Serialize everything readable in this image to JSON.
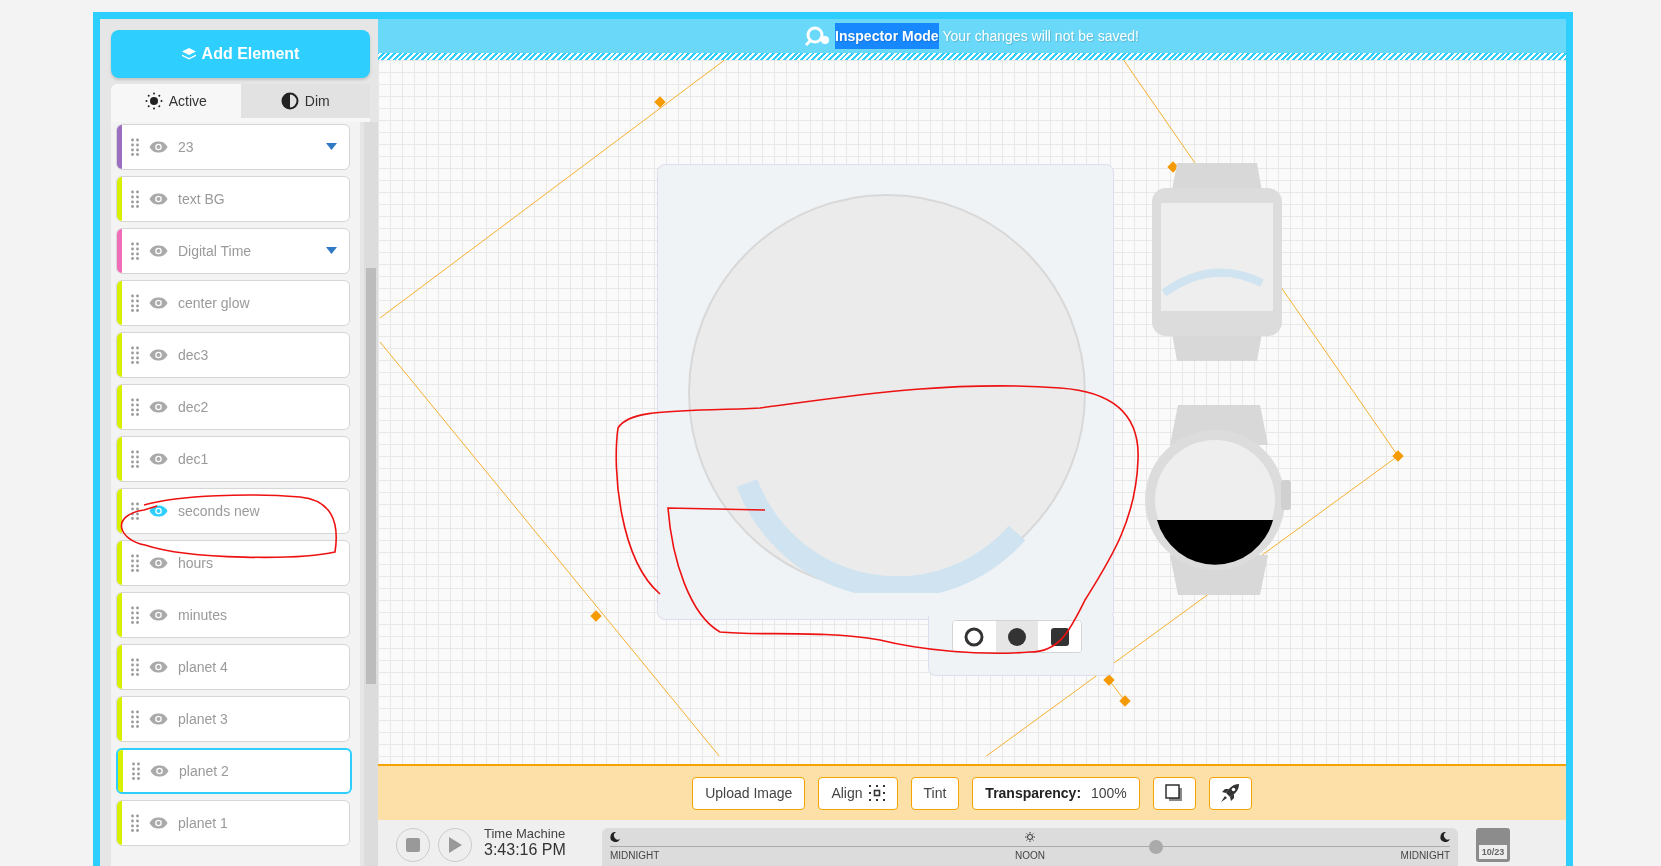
{
  "banner": {
    "mode": "Inspector Mode",
    "message": "Your changes will not be saved!"
  },
  "sidebar": {
    "add_button": "Add Element",
    "tabs": [
      {
        "label": "Active",
        "kind": "sun",
        "selected": true
      },
      {
        "label": "Dim",
        "kind": "half",
        "selected": false
      }
    ],
    "layers": [
      {
        "name": "23",
        "color": "#9b6fbf",
        "expandable": true,
        "highlighted": false,
        "selected": false
      },
      {
        "name": "text BG",
        "color": "#d8f000",
        "expandable": false,
        "highlighted": false,
        "selected": false
      },
      {
        "name": "Digital Time",
        "color": "#f06eb8",
        "expandable": true,
        "highlighted": false,
        "selected": false
      },
      {
        "name": "center glow",
        "color": "#d8f000",
        "expandable": false,
        "highlighted": false,
        "selected": false
      },
      {
        "name": "dec3",
        "color": "#d8f000",
        "expandable": false,
        "highlighted": false,
        "selected": false
      },
      {
        "name": "dec2",
        "color": "#d8f000",
        "expandable": false,
        "highlighted": false,
        "selected": false
      },
      {
        "name": "dec1",
        "color": "#d8f000",
        "expandable": false,
        "highlighted": false,
        "selected": false
      },
      {
        "name": "seconds new",
        "color": "#d8f000",
        "expandable": false,
        "highlighted": true,
        "selected": false
      },
      {
        "name": "hours",
        "color": "#d8f000",
        "expandable": false,
        "highlighted": false,
        "selected": false
      },
      {
        "name": "minutes",
        "color": "#d8f000",
        "expandable": false,
        "highlighted": false,
        "selected": false
      },
      {
        "name": "planet 4",
        "color": "#d8f000",
        "expandable": false,
        "highlighted": false,
        "selected": false
      },
      {
        "name": "planet 3",
        "color": "#d8f000",
        "expandable": false,
        "highlighted": false,
        "selected": false
      },
      {
        "name": "planet 2",
        "color": "#d8f000",
        "expandable": false,
        "highlighted": false,
        "selected": true
      },
      {
        "name": "planet 1",
        "color": "#d8f000",
        "expandable": false,
        "highlighted": false,
        "selected": false
      }
    ]
  },
  "shape_options": [
    {
      "kind": "ring",
      "selected": false
    },
    {
      "kind": "circle",
      "selected": true
    },
    {
      "kind": "square",
      "selected": false
    }
  ],
  "toolbar": [
    {
      "kind": "text",
      "label": "Upload Image"
    },
    {
      "kind": "align",
      "label": "Align"
    },
    {
      "kind": "text",
      "label": "Tint"
    },
    {
      "kind": "transparency",
      "label": "Transparency:",
      "value": "100%"
    },
    {
      "kind": "layers"
    },
    {
      "kind": "rocket"
    }
  ],
  "time_machine": {
    "title": "Time Machine",
    "time": "3:43:16 PM",
    "labels": [
      "MIDNIGHT",
      "NOON",
      "MIDNIGHT"
    ],
    "level": 0.65,
    "date": "10/23"
  }
}
